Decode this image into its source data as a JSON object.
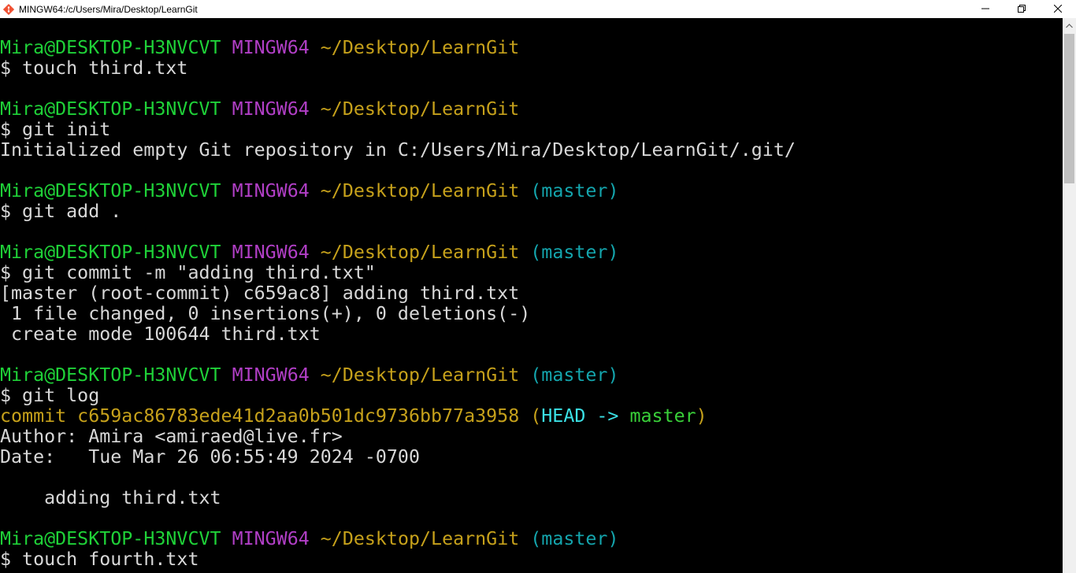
{
  "window": {
    "title": "MINGW64:/c/Users/Mira/Desktop/LearnGit"
  },
  "prompt": {
    "user": "Mira@DESKTOP-H3NVCVT",
    "system": "MINGW64",
    "path": "~/Desktop/LearnGit",
    "branch": "(master)"
  },
  "commands": {
    "c1": "$ touch third.txt",
    "c2": "$ git init",
    "c3": "$ git add .",
    "c4": "$ git commit -m \"adding third.txt\"",
    "c5": "$ git log",
    "c6": "$ touch fourth.txt"
  },
  "output": {
    "init": "Initialized empty Git repository in C:/Users/Mira/Desktop/LearnGit/.git/",
    "commit_header": "[master (root-commit) c659ac8] adding third.txt",
    "commit_stats": " 1 file changed, 0 insertions(+), 0 deletions(-)",
    "commit_create": " create mode 100644 third.txt",
    "log_commit": "commit c659ac86783ede41d2aa0b501dc9736bb77a3958",
    "log_paren_open": "(",
    "log_head": "HEAD -> ",
    "log_branch": "master",
    "log_paren_close": ")",
    "log_author": "Author: Amira <amiraed@live.fr>",
    "log_date": "Date:   Tue Mar 26 06:55:49 2024 -0700",
    "log_message": "    adding third.txt"
  },
  "colors": {
    "user": "#1fd138",
    "system": "#b13fc6",
    "path": "#c6a11b",
    "branch": "#14a5ad",
    "head": "#3be1e6",
    "master": "#39d039",
    "text": "#d8d8d8",
    "background": "#000000"
  },
  "icons": {
    "app": "git-bash-icon",
    "minimize": "minimize-icon",
    "maximize": "restore-icon",
    "close": "close-icon",
    "scroll_up": "chevron-up-icon",
    "scroll_down": "chevron-down-icon"
  }
}
